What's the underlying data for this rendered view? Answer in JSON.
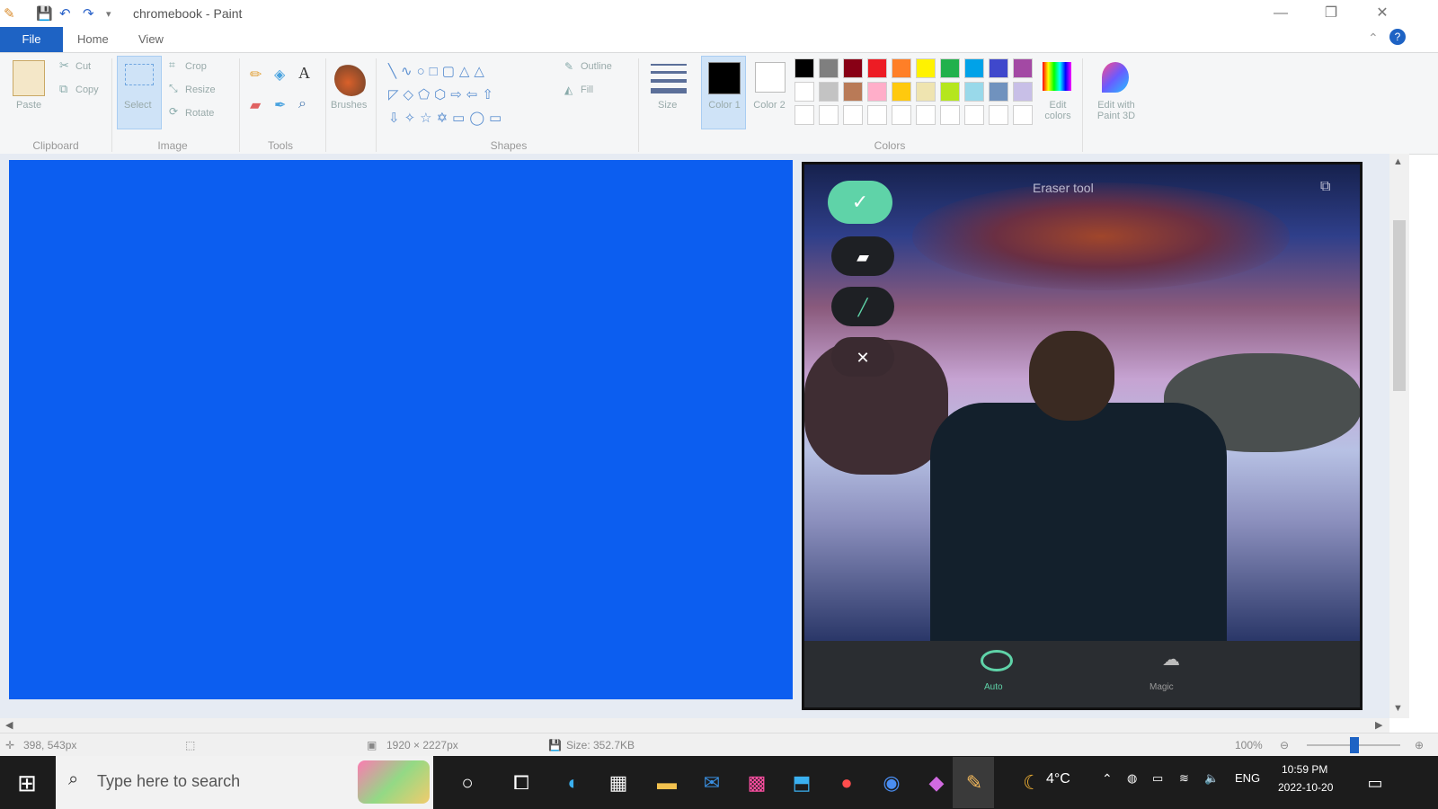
{
  "window": {
    "title": "chromebook - Paint",
    "minimize": "—",
    "restore": "❐",
    "close": "✕"
  },
  "menu": {
    "file": "File",
    "home": "Home",
    "view": "View"
  },
  "ribbon": {
    "clipboard": {
      "paste": "Paste",
      "cut": "Cut",
      "copy": "Copy",
      "label": "Clipboard"
    },
    "image": {
      "select": "Select",
      "crop": "Crop",
      "resize": "Resize",
      "rotate": "Rotate",
      "label": "Image"
    },
    "tools": {
      "label": "Tools"
    },
    "brushes": {
      "label": "Brushes"
    },
    "shapes": {
      "outline": "Outline",
      "fill": "Fill",
      "label": "Shapes"
    },
    "size": {
      "label": "Size"
    },
    "color1": {
      "label": "Color 1"
    },
    "color2": {
      "label": "Color 2"
    },
    "colors": {
      "label": "Colors",
      "edit": "Edit colors",
      "paint3d": "Edit with Paint 3D"
    }
  },
  "palette": {
    "row1": [
      "#000000",
      "#7f7f7f",
      "#880015",
      "#ed1c24",
      "#ff7f27",
      "#fff200",
      "#22b14c",
      "#00a2e8",
      "#3f48cc",
      "#a349a4"
    ],
    "row2": [
      "#ffffff",
      "#c3c3c3",
      "#b97a57",
      "#ffaec9",
      "#ffc90e",
      "#efe4b0",
      "#b5e61d",
      "#99d9ea",
      "#7092be",
      "#c8bfe7"
    ],
    "row3": [
      "#ffffff",
      "#ffffff",
      "#ffffff",
      "#ffffff",
      "#ffffff",
      "#ffffff",
      "#ffffff",
      "#ffffff",
      "#ffffff",
      "#ffffff"
    ]
  },
  "phone": {
    "header": "Eraser tool",
    "tab_left": "Auto",
    "tab_right": "Magic"
  },
  "status": {
    "cursor": "398, 543px",
    "dimensions": "1920 × 2227px",
    "size": "Size: 352.7KB",
    "zoom": "100%"
  },
  "taskbar": {
    "search_placeholder": "Type here to search",
    "weather": "4°C",
    "language": "ENG",
    "time": "10:59 PM",
    "date": "2022-10-20"
  }
}
